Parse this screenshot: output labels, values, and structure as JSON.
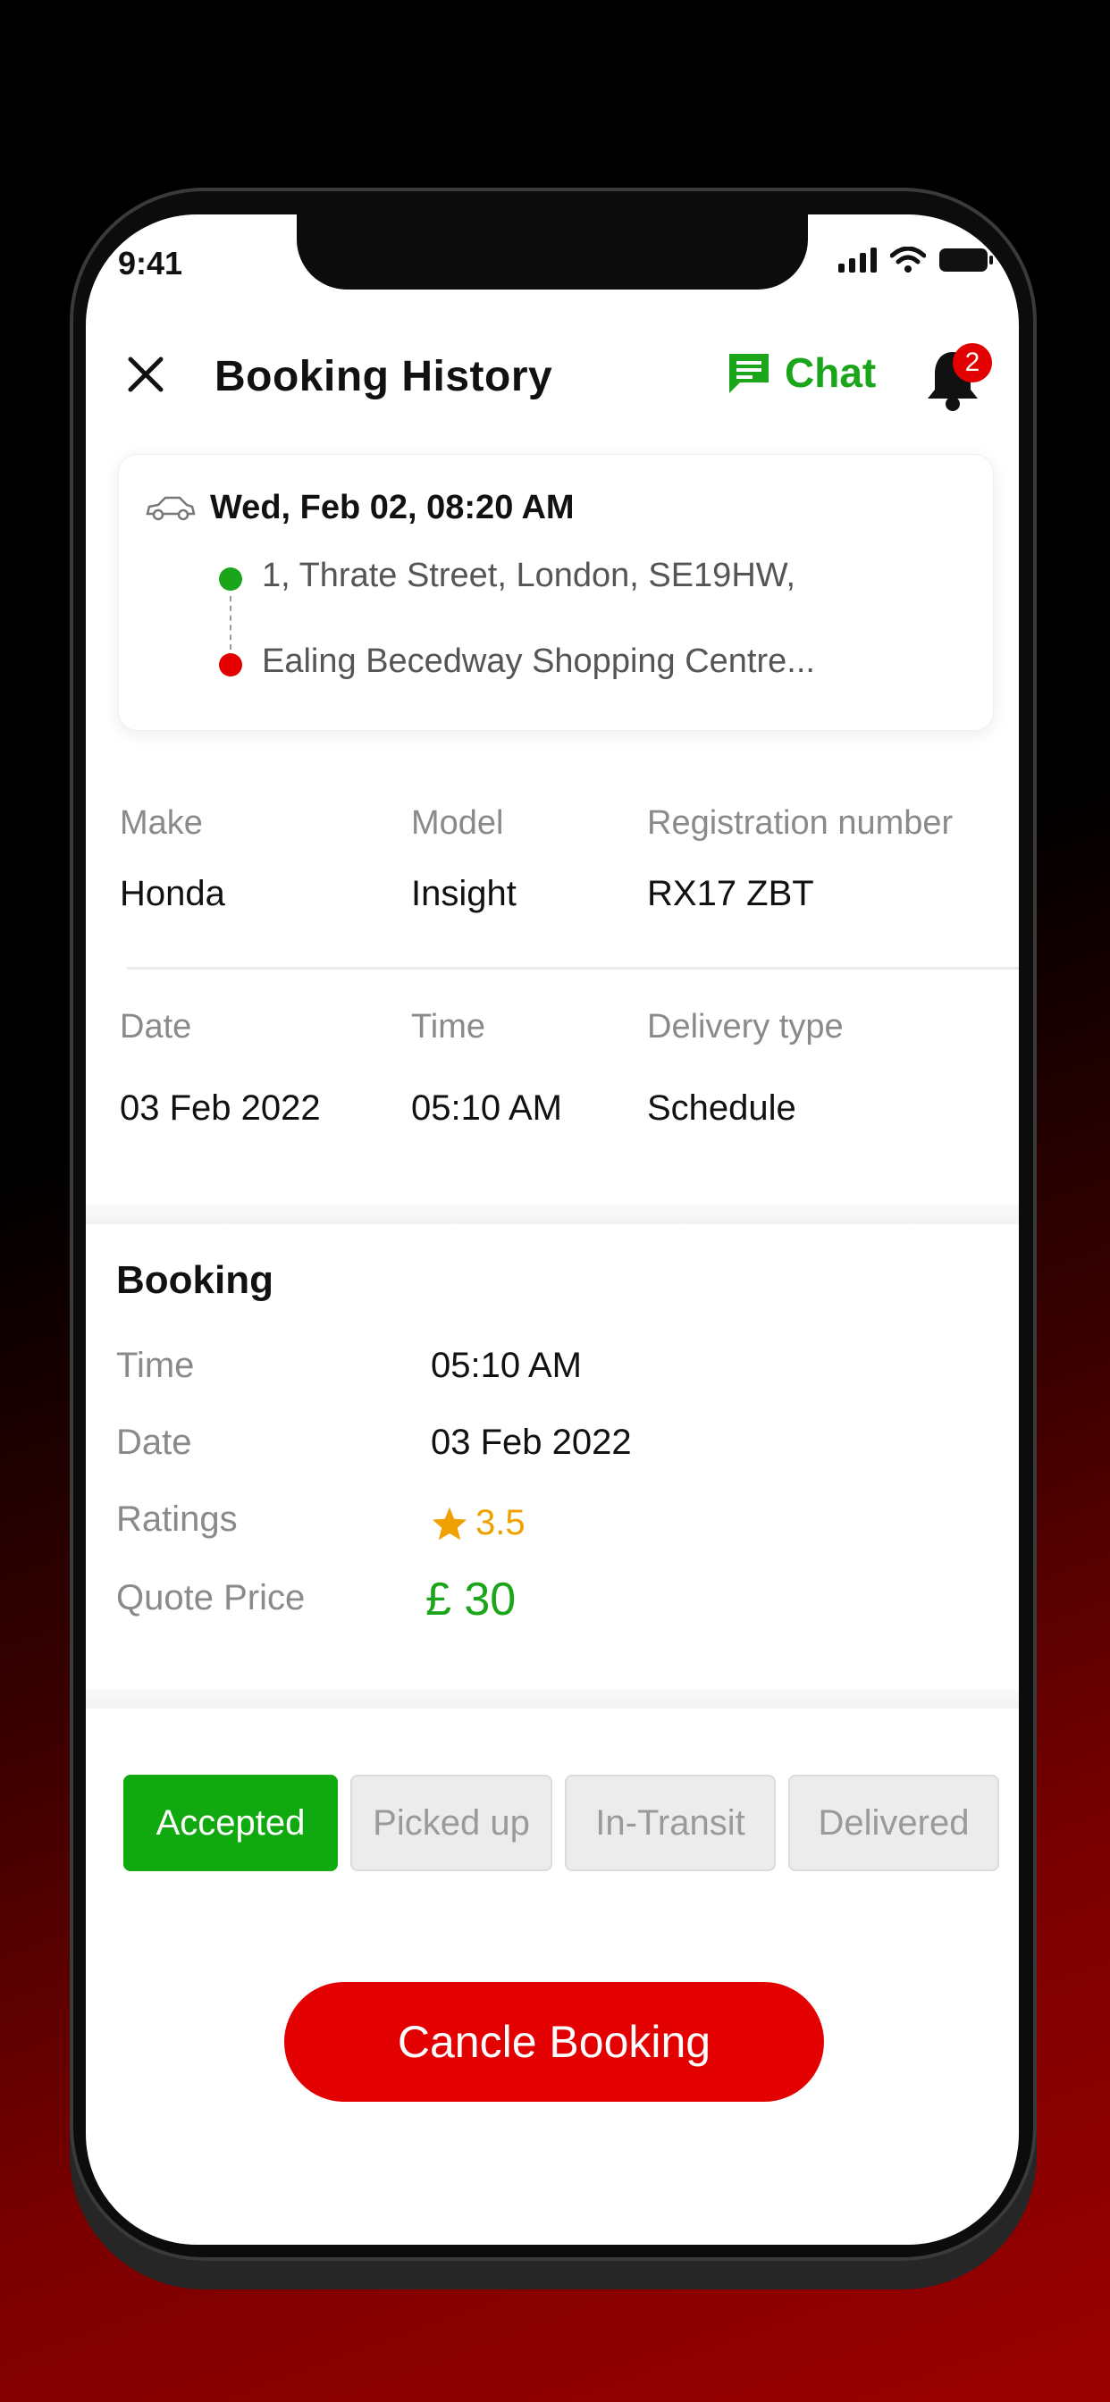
{
  "status_bar": {
    "time": "9:41"
  },
  "header": {
    "title": "Booking History",
    "chat_label": "Chat",
    "notification_count": "2"
  },
  "trip": {
    "datetime": "Wed, Feb 02, 08:20 AM",
    "pickup": "1, Thrate Street, London, SE19HW,",
    "dropoff": "Ealing Becedway Shopping Centre..."
  },
  "vehicle": {
    "make_label": "Make",
    "make": "Honda",
    "model_label": "Model",
    "model": "Insight",
    "reg_label": "Registration number",
    "reg": "RX17 ZBT",
    "date_label": "Date",
    "date": "03 Feb 2022",
    "time_label": "Time",
    "time": "05:10 AM",
    "delivery_label": "Delivery type",
    "delivery": "Schedule"
  },
  "booking": {
    "title": "Booking",
    "time_label": "Time",
    "time": "05:10 AM",
    "date_label": "Date",
    "date": "03 Feb 2022",
    "ratings_label": "Ratings",
    "rating": "3.5",
    "price_label": "Quote Price",
    "price": "£ 30"
  },
  "steps": [
    {
      "label": "Accepted",
      "active": true
    },
    {
      "label": "Picked up",
      "active": false
    },
    {
      "label": "In-Transit",
      "active": false
    },
    {
      "label": "Delivered",
      "active": false
    }
  ],
  "cancel_label": "Cancle Booking",
  "colors": {
    "accent_green": "#1aa51a",
    "accent_red": "#e30000",
    "rating_star": "#f0a000"
  },
  "icons": [
    "close-icon",
    "chat-icon",
    "bell-icon",
    "car-icon",
    "star-icon",
    "signal-icon",
    "wifi-icon",
    "battery-icon"
  ]
}
